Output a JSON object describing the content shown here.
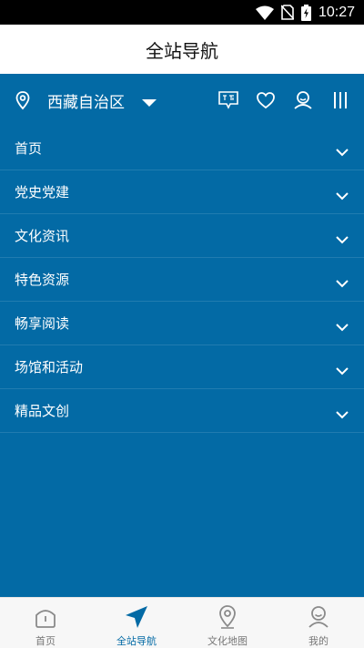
{
  "status_bar": {
    "time": "10:27"
  },
  "app_bar": {
    "title": "全站导航"
  },
  "region": {
    "name": "西藏自治区"
  },
  "nav_items": [
    {
      "label": "首页"
    },
    {
      "label": "党史党建"
    },
    {
      "label": "文化资讯"
    },
    {
      "label": "特色资源"
    },
    {
      "label": "畅享阅读"
    },
    {
      "label": "场馆和活动"
    },
    {
      "label": "精品文创"
    }
  ],
  "tabs": [
    {
      "label": "首页",
      "icon": "home-icon",
      "active": false
    },
    {
      "label": "全站导航",
      "icon": "navigation-arrow-icon",
      "active": true
    },
    {
      "label": "文化地图",
      "icon": "map-pin-icon",
      "active": false
    },
    {
      "label": "我的",
      "icon": "profile-icon",
      "active": false
    }
  ],
  "colors": {
    "primary": "#036aa5",
    "tab_inactive": "#777777"
  }
}
